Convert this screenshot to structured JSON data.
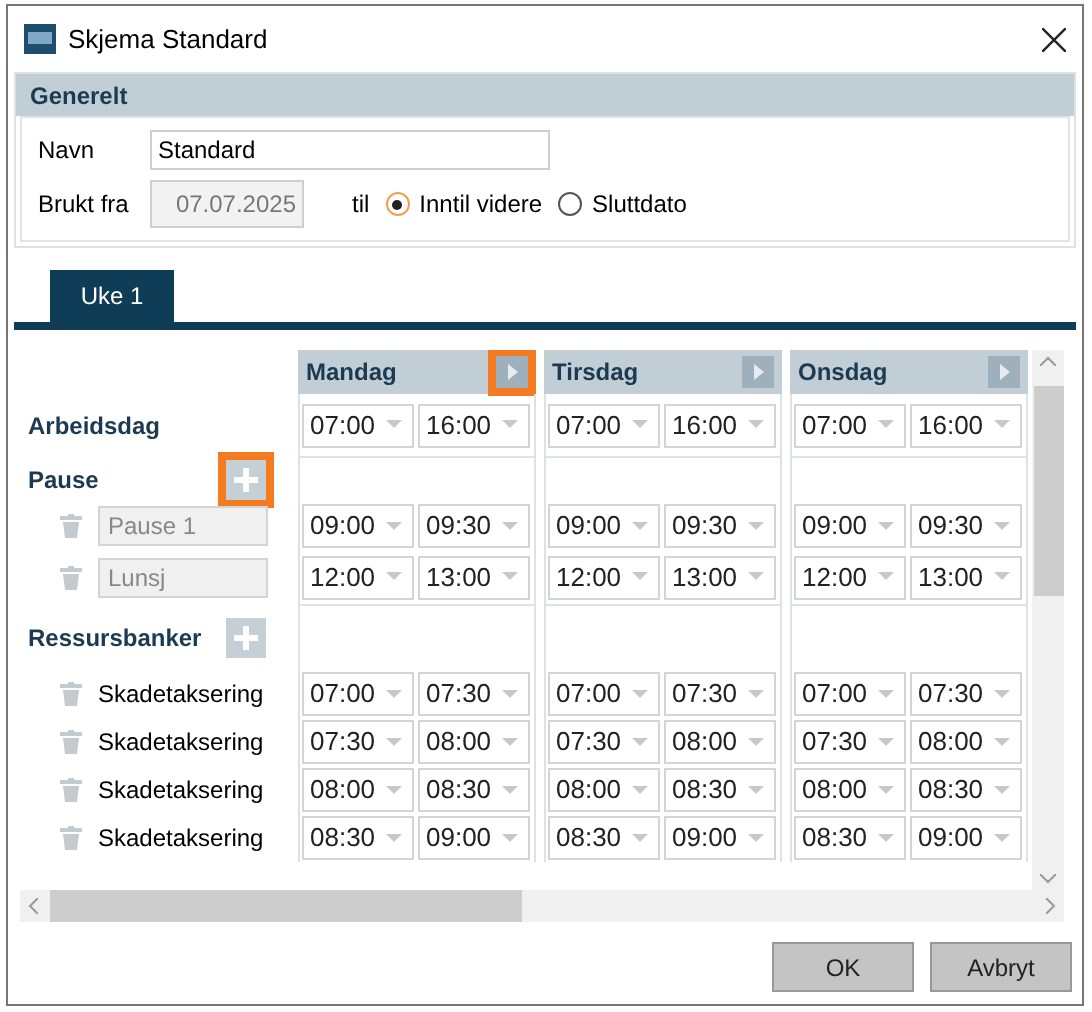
{
  "window": {
    "title": "Skjema Standard"
  },
  "general": {
    "heading": "Generelt",
    "name_label": "Navn",
    "name_value": "Standard",
    "from_label": "Brukt fra",
    "from_value": "07.07.2025",
    "to_label": "til",
    "end_options": [
      {
        "label": "Inntil videre",
        "selected": true
      },
      {
        "label": "Sluttdato",
        "selected": false
      }
    ]
  },
  "tabs": [
    {
      "label": "Uke 1",
      "selected": true
    }
  ],
  "days": [
    {
      "name": "Mandag",
      "highlighted": true
    },
    {
      "name": "Tirsdag",
      "highlighted": false
    },
    {
      "name": "Onsdag",
      "highlighted": false
    }
  ],
  "workday": {
    "label": "Arbeidsdag",
    "times": [
      {
        "start": "07:00",
        "end": "16:00"
      },
      {
        "start": "07:00",
        "end": "16:00"
      },
      {
        "start": "07:00",
        "end": "16:00"
      }
    ]
  },
  "pause": {
    "label": "Pause",
    "add_highlighted": true,
    "items": [
      {
        "name": "Pause 1",
        "times": [
          {
            "start": "09:00",
            "end": "09:30"
          },
          {
            "start": "09:00",
            "end": "09:30"
          },
          {
            "start": "09:00",
            "end": "09:30"
          }
        ]
      },
      {
        "name": "Lunsj",
        "times": [
          {
            "start": "12:00",
            "end": "13:00"
          },
          {
            "start": "12:00",
            "end": "13:00"
          },
          {
            "start": "12:00",
            "end": "13:00"
          }
        ]
      }
    ]
  },
  "resources": {
    "label": "Ressursbanker",
    "add_highlighted": false,
    "items": [
      {
        "name": "Skadetaksering",
        "times": [
          {
            "start": "07:00",
            "end": "07:30"
          },
          {
            "start": "07:00",
            "end": "07:30"
          },
          {
            "start": "07:00",
            "end": "07:30"
          }
        ]
      },
      {
        "name": "Skadetaksering",
        "times": [
          {
            "start": "07:30",
            "end": "08:00"
          },
          {
            "start": "07:30",
            "end": "08:00"
          },
          {
            "start": "07:30",
            "end": "08:00"
          }
        ]
      },
      {
        "name": "Skadetaksering",
        "times": [
          {
            "start": "08:00",
            "end": "08:30"
          },
          {
            "start": "08:00",
            "end": "08:30"
          },
          {
            "start": "08:00",
            "end": "08:30"
          }
        ]
      },
      {
        "name": "Skadetaksering",
        "times": [
          {
            "start": "08:30",
            "end": "09:00"
          },
          {
            "start": "08:30",
            "end": "09:00"
          },
          {
            "start": "08:30",
            "end": "09:00"
          }
        ]
      }
    ]
  },
  "buttons": [
    "OK",
    "Avbryt"
  ]
}
